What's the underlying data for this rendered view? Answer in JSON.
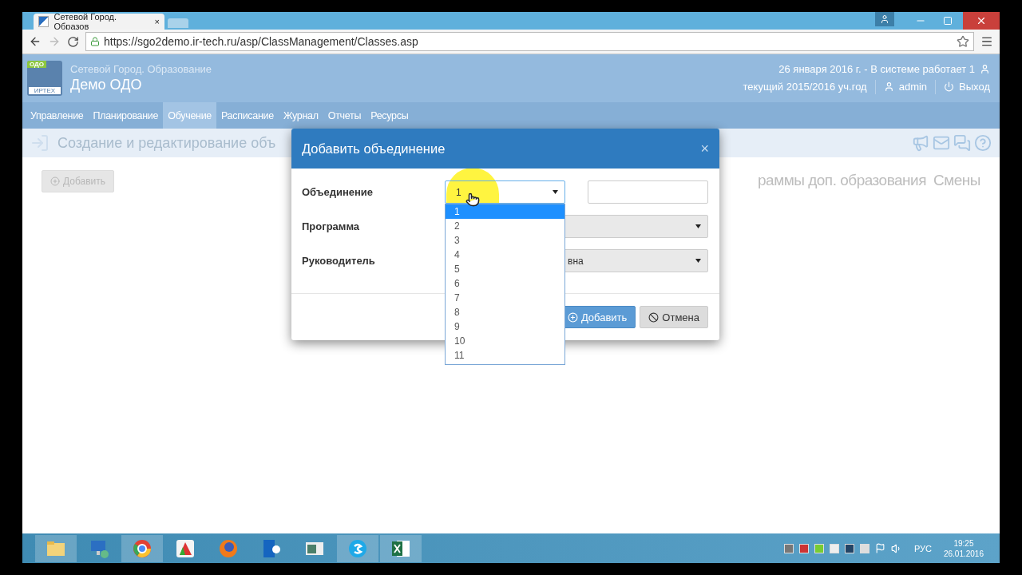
{
  "browser": {
    "tab_title": "Сетевой Город. Образов",
    "tab_close": "×",
    "url": "https://sgo2demo.ir-tech.ru/asp/ClassManagement/Classes.asp"
  },
  "header": {
    "logo_top": "ОДО",
    "logo_bottom": "ИРТЕХ",
    "subtitle": "Сетевой Город. Образование",
    "title": "Демо ОДО",
    "status": "26 января 2016 г. - В системе работает 1",
    "school_year": "текущий 2015/2016 уч.год",
    "user": "admin",
    "logout": "Выход"
  },
  "nav": [
    {
      "label": "Управление",
      "selected": false
    },
    {
      "label": "Планирование",
      "selected": false
    },
    {
      "label": "Обучение",
      "selected": true
    },
    {
      "label": "Расписание",
      "selected": false
    },
    {
      "label": "Журнал",
      "selected": false
    },
    {
      "label": "Отчеты",
      "selected": false
    },
    {
      "label": "Ресурсы",
      "selected": false
    }
  ],
  "page": {
    "title": "Создание и редактирование объ",
    "add_button": "Добавить",
    "tabs": [
      "раммы доп. образования",
      "Смены"
    ]
  },
  "modal": {
    "title": "Добавить объединение",
    "close": "×",
    "fields": [
      {
        "kind": "select-input",
        "label": "Объединение",
        "value": "1",
        "open": true
      },
      {
        "kind": "select",
        "label": "Программа",
        "open": false
      },
      {
        "kind": "select",
        "label": "Руководитель",
        "value": "вна",
        "open": false
      }
    ],
    "options": [
      {
        "label": "1",
        "selected": true
      },
      {
        "label": "2",
        "selected": false
      },
      {
        "label": "3",
        "selected": false
      },
      {
        "label": "4",
        "selected": false
      },
      {
        "label": "5",
        "selected": false
      },
      {
        "label": "6",
        "selected": false
      },
      {
        "label": "7",
        "selected": false
      },
      {
        "label": "8",
        "selected": false
      },
      {
        "label": "9",
        "selected": false
      },
      {
        "label": "10",
        "selected": false
      },
      {
        "label": "11",
        "selected": false
      }
    ],
    "buttons": [
      {
        "kind": "primary",
        "label": "Добавить"
      },
      {
        "kind": "cancel",
        "label": "Отмена"
      }
    ]
  },
  "taskbar": {
    "apps": [
      {
        "kind": "folder",
        "running": true
      },
      {
        "kind": "monitor",
        "running": false
      },
      {
        "kind": "ring",
        "running": true
      },
      {
        "kind": "triangle",
        "running": false
      },
      {
        "kind": "sphere",
        "running": false
      },
      {
        "kind": "tile",
        "running": false
      },
      {
        "kind": "window",
        "running": false
      },
      {
        "kind": "chat",
        "running": true
      },
      {
        "kind": "sheet",
        "running": true
      }
    ],
    "language": "РУС",
    "time": "19:25",
    "date": "26.01.2016"
  }
}
